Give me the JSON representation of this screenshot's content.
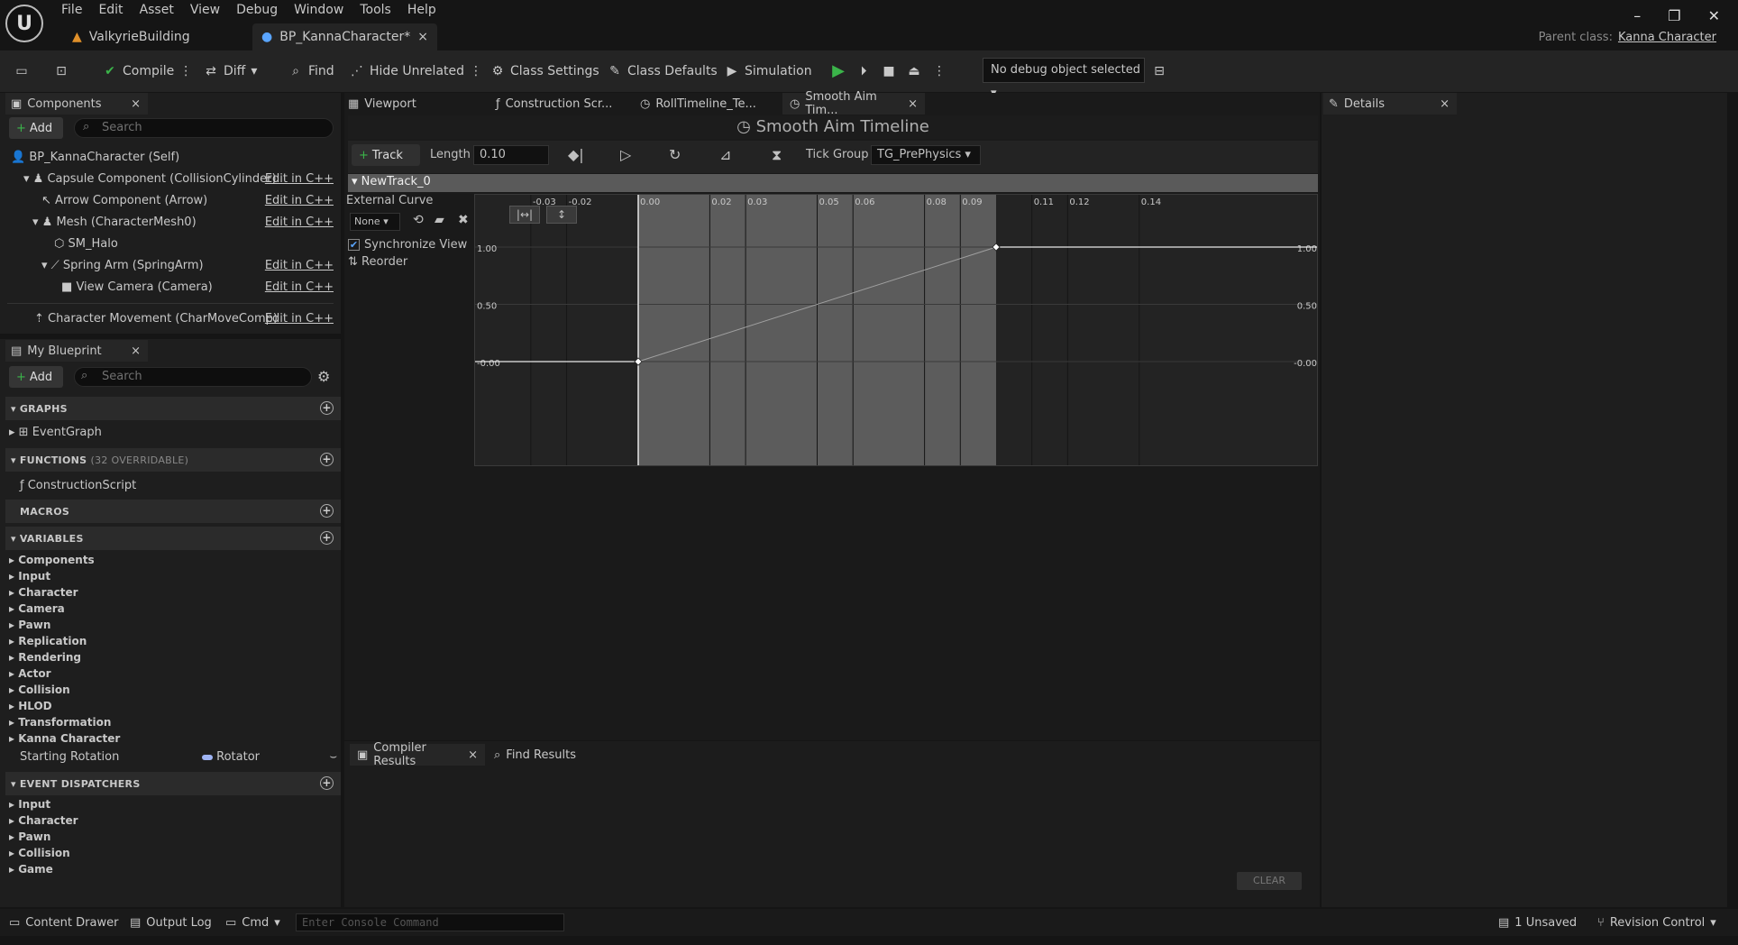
{
  "menu": [
    "File",
    "Edit",
    "Asset",
    "View",
    "Debug",
    "Window",
    "Tools",
    "Help"
  ],
  "doc_tabs": [
    {
      "label": "ValkyrieBuilding"
    },
    {
      "label": "BP_KannaCharacter*"
    }
  ],
  "parent_class": {
    "label": "Parent class:",
    "value": "Kanna Character"
  },
  "toolbar": {
    "compile": "Compile",
    "diff": "Diff",
    "find": "Find",
    "hide_unrelated": "Hide Unrelated",
    "class_settings": "Class Settings",
    "class_defaults": "Class Defaults",
    "simulation": "Simulation",
    "debug_object": "No debug object selected"
  },
  "components": {
    "title": "Components",
    "add": "Add",
    "search_placeholder": "Search",
    "items": [
      {
        "label": "BP_KannaCharacter (Self)",
        "edit": ""
      },
      {
        "label": "Capsule Component (CollisionCylinder)",
        "edit": "Edit in C++"
      },
      {
        "label": "Arrow Component (Arrow)",
        "edit": "Edit in C++"
      },
      {
        "label": "Mesh (CharacterMesh0)",
        "edit": "Edit in C++"
      },
      {
        "label": "SM_Halo",
        "edit": ""
      },
      {
        "label": "Spring Arm (SpringArm)",
        "edit": "Edit in C++"
      },
      {
        "label": "View Camera (Camera)",
        "edit": "Edit in C++"
      },
      {
        "label": "Character Movement (CharMoveComp)",
        "edit": "Edit in C++"
      }
    ]
  },
  "my_blueprint": {
    "title": "My Blueprint",
    "add": "Add",
    "search_placeholder": "Search",
    "graphs": "GRAPHS",
    "event_graph": "EventGraph",
    "functions": "FUNCTIONS",
    "functions_count": "(32 OVERRIDABLE)",
    "construction_script": "ConstructionScript",
    "macros": "MACROS",
    "variables": "VARIABLES",
    "variable_groups": [
      "Components",
      "Input",
      "Character",
      "Camera",
      "Pawn",
      "Replication",
      "Rendering",
      "Actor",
      "Collision",
      "HLOD",
      "Transformation",
      "Kanna Character"
    ],
    "starting_rotation": {
      "name": "Starting Rotation",
      "type": "Rotator"
    },
    "event_dispatchers": "EVENT DISPATCHERS",
    "dispatcher_groups": [
      "Input",
      "Character",
      "Pawn",
      "Collision",
      "Game"
    ]
  },
  "editor_tabs": [
    "Viewport",
    "Construction Scr...",
    "RollTimeline_Te...",
    "Smooth Aim Tim..."
  ],
  "timeline": {
    "title": "Smooth Aim Timeline",
    "track_btn": "Track",
    "length_label": "Length",
    "length_value": "0.10",
    "tick_group_label": "Tick Group",
    "tick_group_value": "TG_PrePhysics",
    "track_name": "NewTrack_0",
    "external_curve": "External Curve",
    "curve_value": "None",
    "sync_view": "Synchronize View",
    "reorder": "Reorder"
  },
  "chart_data": {
    "type": "line",
    "x_ticks": [
      "-0.03",
      "-0.02",
      "0.00",
      "0.02",
      "0.03",
      "0.05",
      "0.06",
      "0.08",
      "0.09",
      "0.11",
      "0.12",
      "0.14"
    ],
    "y_ticks": [
      "1.00",
      "0.50",
      "-0.00"
    ],
    "series": [
      {
        "x": [
          0.0,
          0.1
        ],
        "y": [
          0.0,
          1.0
        ]
      }
    ],
    "active_range": [
      0.0,
      0.1
    ]
  },
  "details": {
    "title": "Details"
  },
  "bottom_tabs": {
    "compiler_results": "Compiler Results",
    "find_results": "Find Results",
    "clear": "CLEAR"
  },
  "status": {
    "content_drawer": "Content Drawer",
    "output_log": "Output Log",
    "cmd": "Cmd",
    "console_placeholder": "Enter Console Command",
    "unsaved": "1 Unsaved",
    "revision": "Revision Control"
  }
}
